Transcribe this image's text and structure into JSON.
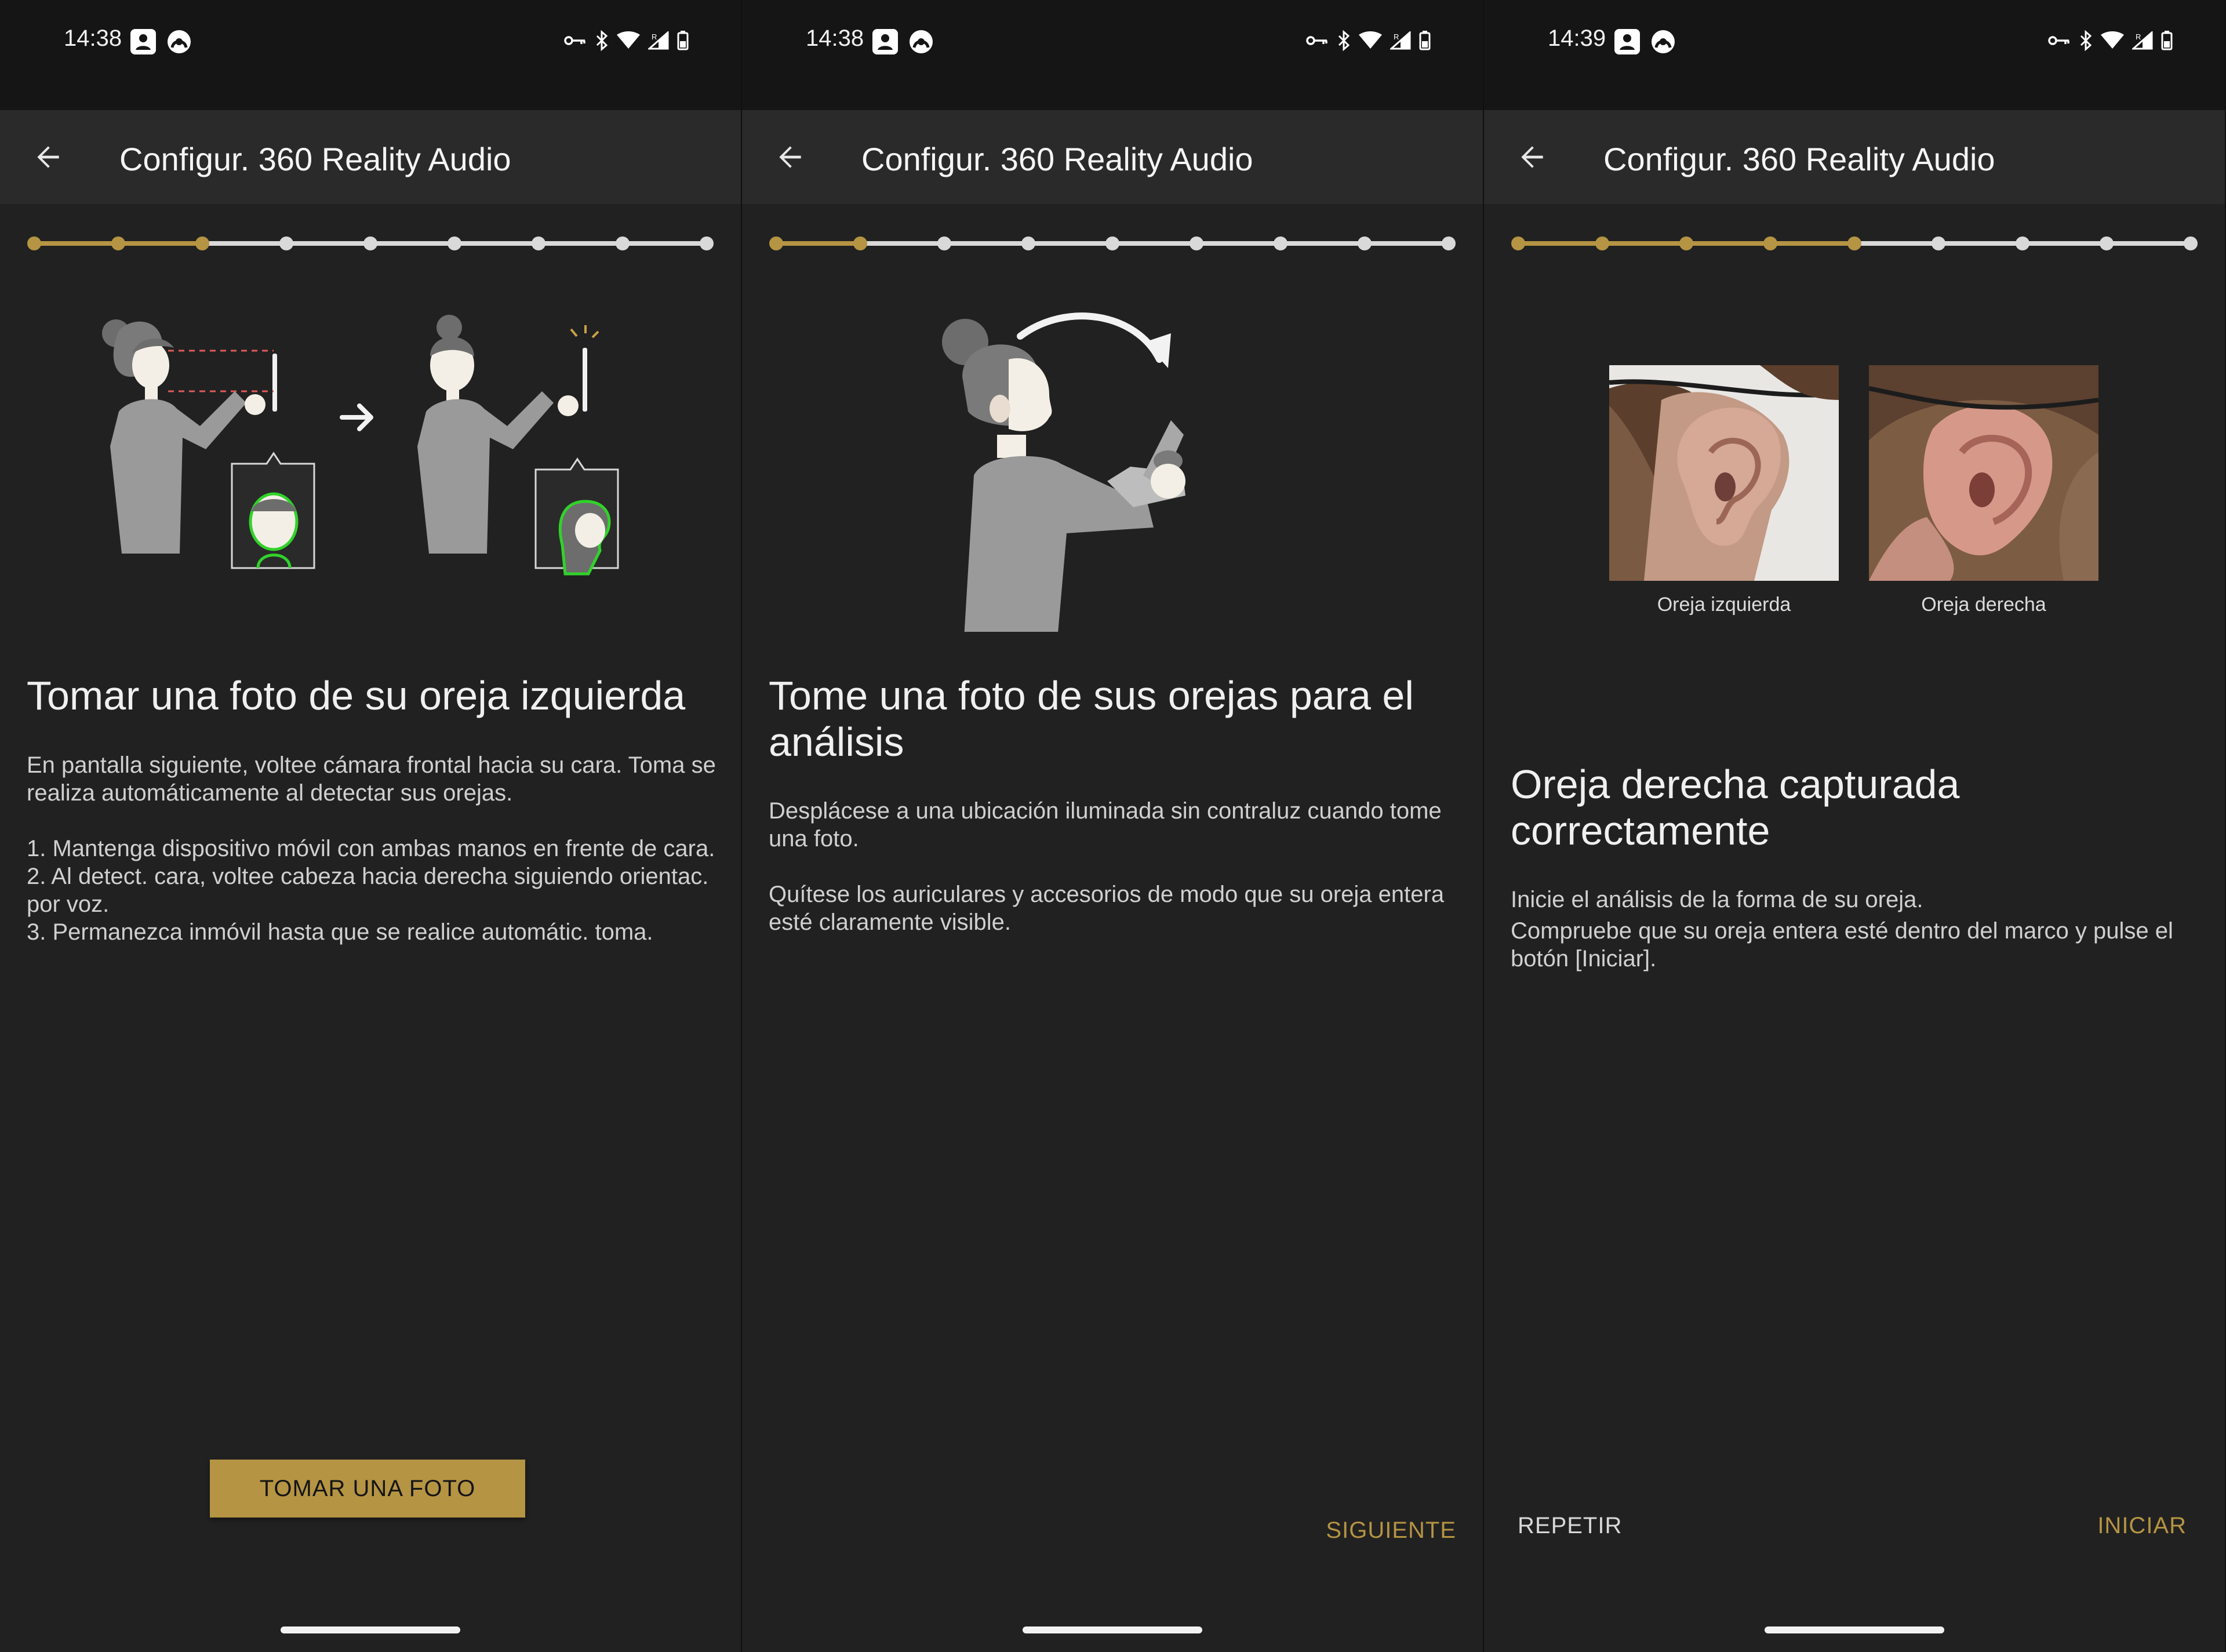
{
  "colors": {
    "accent": "#b59443",
    "background": "#212121",
    "appbar": "#2a2a2a",
    "progress_inactive": "#d9d9d9"
  },
  "screens": [
    {
      "status": {
        "time": "14:38"
      },
      "appbar": {
        "title": "Configur. 360 Reality Audio",
        "back_icon": "arrow-left-icon"
      },
      "progress": {
        "total_steps": 9,
        "current_step": 3
      },
      "title": "Tomar una foto de su oreja izquierda",
      "body": [
        "En pantalla siguiente, voltee cámara frontal hacia su cara. Toma se realiza automáticamente al detectar sus orejas.",
        "1. Mantenga dispositivo móvil con ambas manos en frente de cara.",
        "2. Al detect. cara, voltee cabeza hacia derecha siguiendo orientac. por voz.",
        "3. Permanezca inmóvil hasta que se realice automátic. toma."
      ],
      "primary_button": "TOMAR UNA FOTO"
    },
    {
      "status": {
        "time": "14:38"
      },
      "appbar": {
        "title": "Configur. 360 Reality Audio",
        "back_icon": "arrow-left-icon"
      },
      "progress": {
        "total_steps": 9,
        "current_step": 2
      },
      "title": "Tome una foto de sus orejas para el análisis",
      "body": [
        "Desplácese a una ubicación iluminada sin contraluz cuando tome una foto.",
        "Quítese los auriculares y accesorios de modo que su oreja entera esté claramente visible."
      ],
      "next_button": "SIGUIENTE"
    },
    {
      "status": {
        "time": "14:39"
      },
      "appbar": {
        "title": "Configur. 360 Reality Audio",
        "back_icon": "arrow-left-icon"
      },
      "progress": {
        "total_steps": 9,
        "current_step": 5
      },
      "photos": [
        {
          "caption": "Oreja izquierda"
        },
        {
          "caption": "Oreja derecha"
        }
      ],
      "title": "Oreja derecha capturada correctamente",
      "body": [
        "Inicie el análisis de la forma de su oreja.",
        "Compruebe que su oreja entera esté dentro del marco y pulse el botón [Iniciar]."
      ],
      "repeat_button": "REPETIR",
      "start_button": "INICIAR"
    }
  ]
}
